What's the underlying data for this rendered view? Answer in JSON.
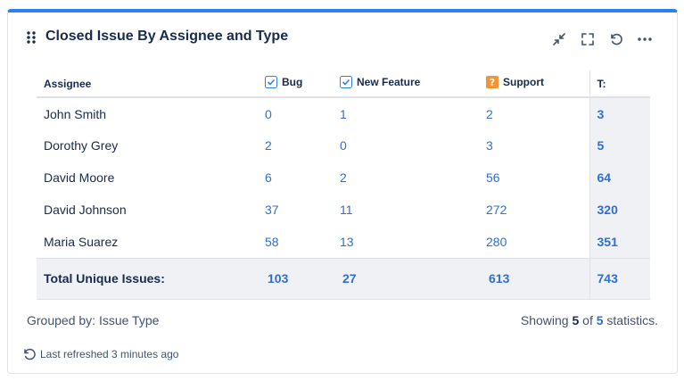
{
  "gadget": {
    "title": "Closed Issue By Assignee and Type",
    "accent_color": "#2f80ed"
  },
  "actions": [
    {
      "name": "minimize-icon"
    },
    {
      "name": "fullscreen-icon"
    },
    {
      "name": "refresh-icon"
    },
    {
      "name": "more-options-icon"
    }
  ],
  "table": {
    "headers": {
      "assignee": "Assignee",
      "bug": "Bug",
      "new_feature": "New Feature",
      "support": "Support",
      "total": "T:"
    },
    "rows": [
      {
        "assignee": "John Smith",
        "bug": "0",
        "new_feature": "1",
        "support": "2",
        "total": "3"
      },
      {
        "assignee": "Dorothy Grey",
        "bug": "2",
        "new_feature": "0",
        "support": "3",
        "total": "5"
      },
      {
        "assignee": "David Moore",
        "bug": "6",
        "new_feature": "2",
        "support": "56",
        "total": "64"
      },
      {
        "assignee": "David Johnson",
        "bug": "37",
        "new_feature": "11",
        "support": "272",
        "total": "320"
      },
      {
        "assignee": "Maria Suarez",
        "bug": "58",
        "new_feature": "13",
        "support": "280",
        "total": "351"
      }
    ],
    "summary": {
      "label": "Total Unique Issues:",
      "bug": "103",
      "new_feature": "27",
      "support": "613",
      "total": "743"
    }
  },
  "footer": {
    "grouped_by": "Grouped by: Issue Type",
    "showing_prefix": "Showing",
    "showing_count": "5",
    "showing_of": "of",
    "showing_total": "5",
    "showing_suffix": "statistics.",
    "last_refreshed": "Last refreshed 3 minutes ago"
  }
}
